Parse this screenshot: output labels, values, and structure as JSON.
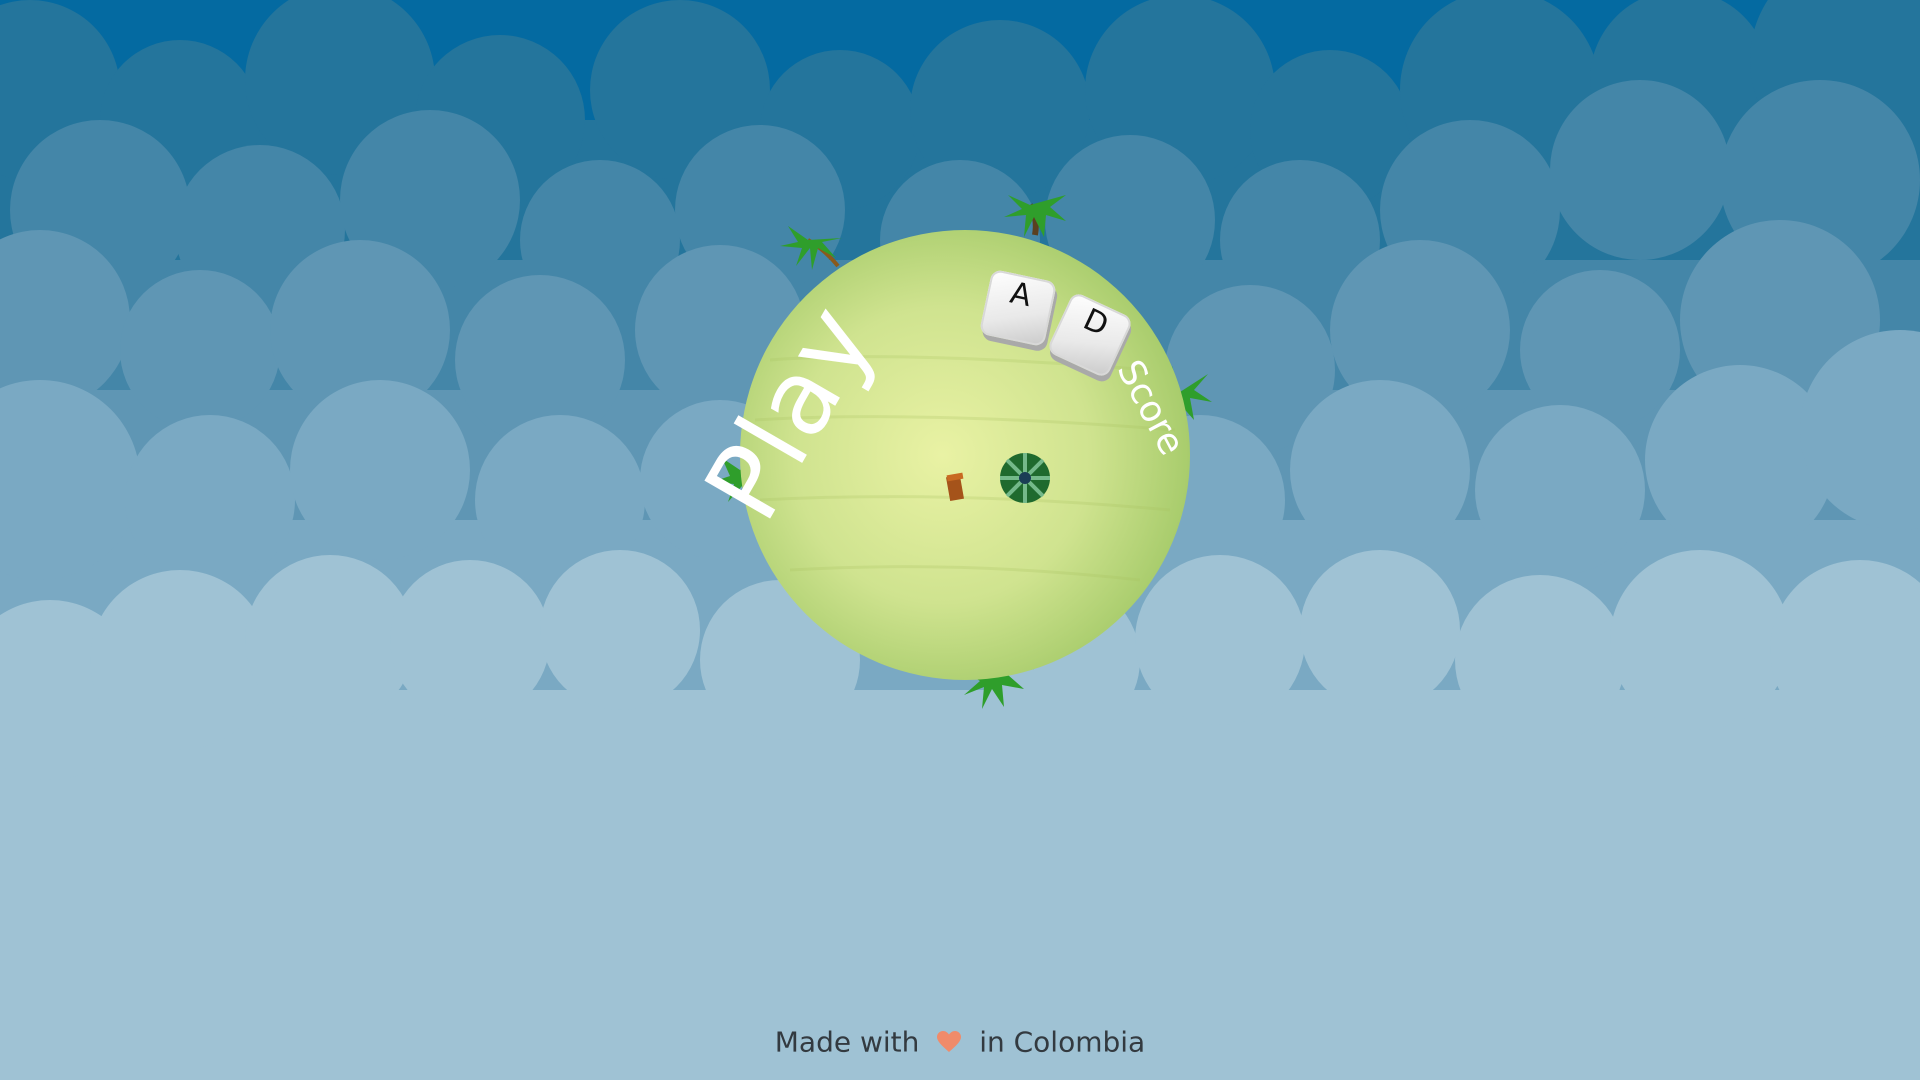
{
  "menu": {
    "play_label": "Play",
    "score_label": "Score"
  },
  "controls": {
    "left_key": "A",
    "right_key": "D"
  },
  "footer": {
    "prefix": "Made with",
    "suffix": "in Colombia",
    "icon": "heart-icon"
  },
  "colors": {
    "sky_top": "#046aa1",
    "planet": "#c9e08c",
    "palm_leaves": "#2f9e2b",
    "heart": "#f08b6a",
    "text_light": "#ffffff",
    "footer_text": "#333a40"
  }
}
